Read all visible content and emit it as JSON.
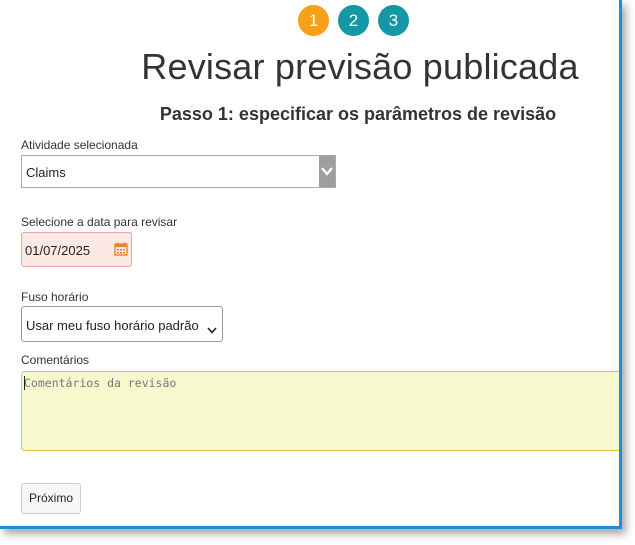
{
  "wizard": {
    "steps": [
      "1",
      "2",
      "3"
    ],
    "active_step": 1,
    "colors": {
      "active": "#f6a01a",
      "inactive": "#1597a6",
      "frame": "#1e8fd6"
    }
  },
  "header": {
    "title": "Revisar previsão publicada",
    "subtitle": "Passo 1: especificar os parâmetros de revisão"
  },
  "form": {
    "activity": {
      "label": "Atividade selecionada",
      "value": "Claims"
    },
    "date": {
      "label": "Selecione a data para revisar",
      "value": "01/07/2025"
    },
    "timezone": {
      "label": "Fuso horário",
      "value": "Usar meu fuso horário padrão"
    },
    "comments": {
      "label": "Comentários",
      "placeholder": "Comentários da revisão"
    }
  },
  "actions": {
    "next_label": "Próximo"
  },
  "icons": {
    "activity_dropdown": "chevron-down-icon",
    "date_picker": "calendar-icon",
    "timezone_dropdown": "chevron-down-icon"
  }
}
